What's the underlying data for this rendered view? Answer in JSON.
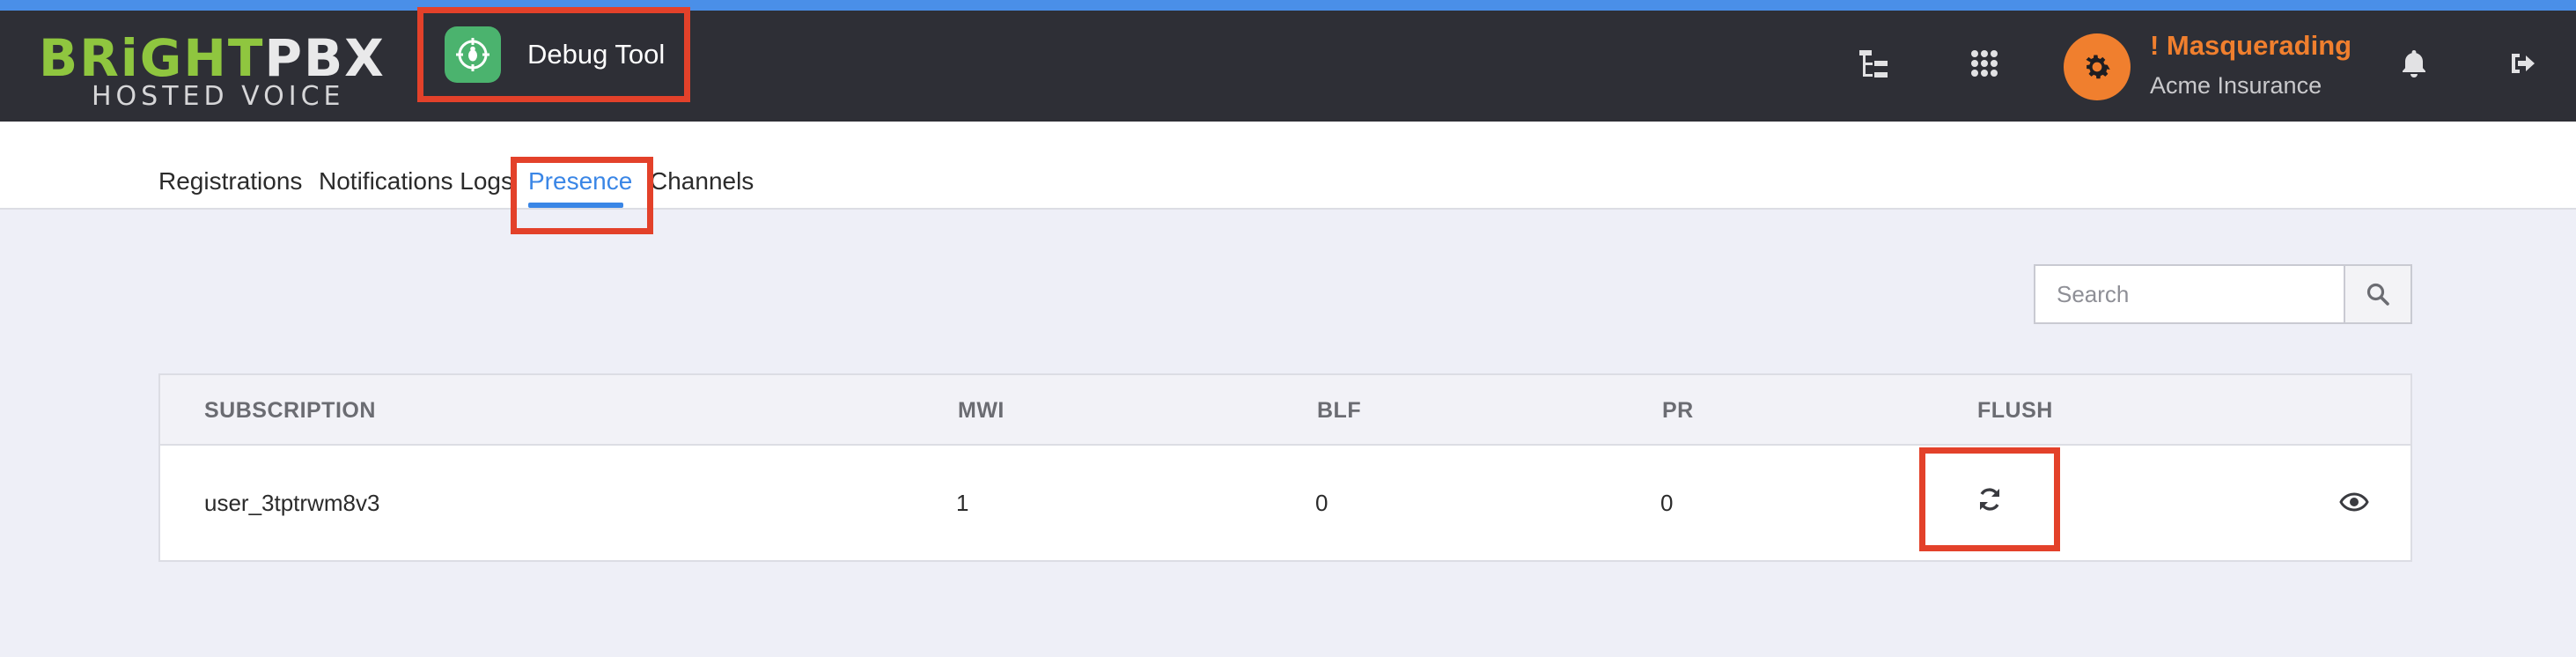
{
  "brand": {
    "logo_part1": "BRiGHT",
    "logo_part2": "PBX",
    "tagline": "HOSTED VOICE"
  },
  "app": {
    "title": "Debug Tool",
    "icon": "bug-target-icon"
  },
  "header": {
    "icons": [
      "tree-hierarchy-icon",
      "apps-grid-icon",
      "bell-icon",
      "sign-out-icon"
    ],
    "avatar_icon": "gear-icon",
    "masquerade_label": "! Masquerading",
    "organization": "Acme Insurance",
    "accent_color": "#f07f2e"
  },
  "tabs": [
    {
      "label": "Registrations",
      "active": false
    },
    {
      "label": "Notifications Logs",
      "active": false
    },
    {
      "label": "Presence",
      "active": true
    },
    {
      "label": "Channels",
      "active": false
    }
  ],
  "search": {
    "placeholder": "Search",
    "value": "",
    "button_icon": "search-icon"
  },
  "table": {
    "columns": [
      "SUBSCRIPTION",
      "MWI",
      "BLF",
      "PR",
      "FLUSH"
    ],
    "rows": [
      {
        "subscription": "user_3tptrwm8v3",
        "mwi": "1",
        "blf": "0",
        "pr": "0",
        "flush_icon": "refresh-icon",
        "action_icon": "eye-icon"
      }
    ]
  },
  "highlight_color": "#e3412a",
  "active_color": "#3a86e6"
}
